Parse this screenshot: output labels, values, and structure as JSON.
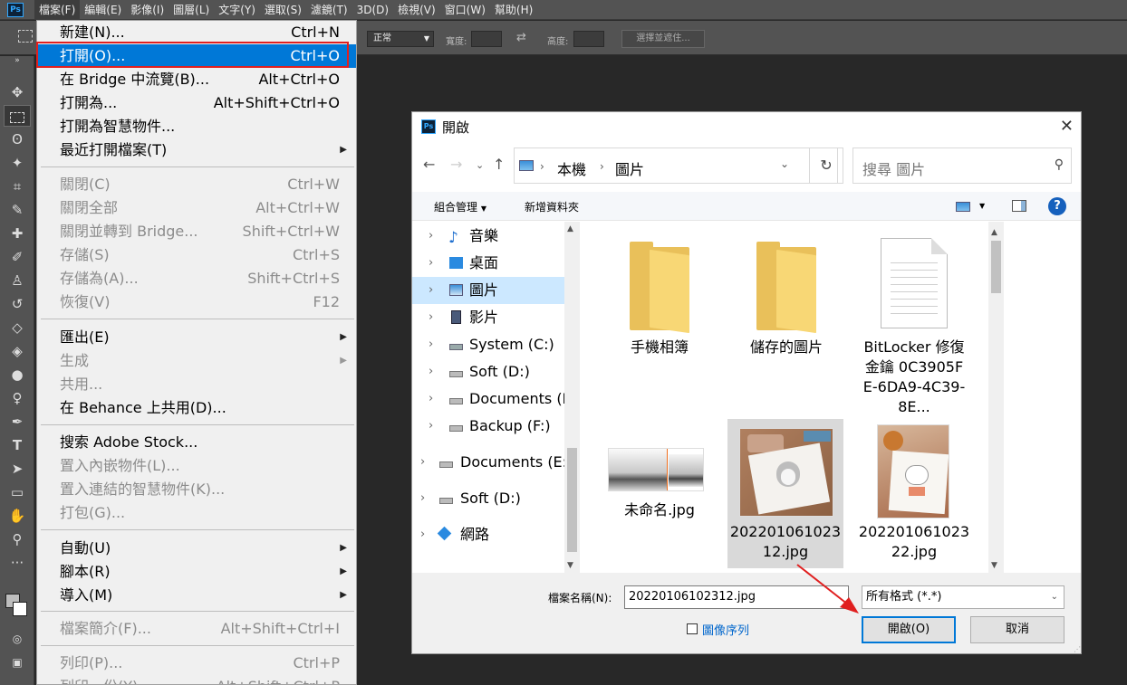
{
  "menubar": {
    "logo": "Ps",
    "items": [
      "檔案(F)",
      "編輯(E)",
      "影像(I)",
      "圖層(L)",
      "文字(Y)",
      "選取(S)",
      "濾鏡(T)",
      "3D(D)",
      "檢視(V)",
      "窗口(W)",
      "幫助(H)"
    ]
  },
  "options": {
    "style_value": "正常",
    "width_label": "寬度:",
    "height_label": "高度:",
    "select_mask": "選擇並遮住..."
  },
  "file_menu": {
    "items": [
      {
        "label": "新建(N)...",
        "shortcut": "Ctrl+N"
      },
      {
        "label": "打開(O)...",
        "shortcut": "Ctrl+O"
      },
      {
        "label": "在 Bridge 中流覽(B)...",
        "shortcut": "Alt+Ctrl+O"
      },
      {
        "label": "打開為...",
        "shortcut": "Alt+Shift+Ctrl+O"
      },
      {
        "label": "打開為智慧物件...",
        "shortcut": ""
      },
      {
        "label": "最近打開檔案(T)",
        "shortcut": ""
      },
      {
        "label": "關閉(C)",
        "shortcut": "Ctrl+W"
      },
      {
        "label": "關閉全部",
        "shortcut": "Alt+Ctrl+W"
      },
      {
        "label": "關閉並轉到 Bridge...",
        "shortcut": "Shift+Ctrl+W"
      },
      {
        "label": "存儲(S)",
        "shortcut": "Ctrl+S"
      },
      {
        "label": "存儲為(A)...",
        "shortcut": "Shift+Ctrl+S"
      },
      {
        "label": "恢復(V)",
        "shortcut": "F12"
      },
      {
        "label": "匯出(E)",
        "shortcut": ""
      },
      {
        "label": "生成",
        "shortcut": ""
      },
      {
        "label": "共用...",
        "shortcut": ""
      },
      {
        "label": "在 Behance 上共用(D)...",
        "shortcut": ""
      },
      {
        "label": "搜索 Adobe Stock...",
        "shortcut": ""
      },
      {
        "label": "置入內嵌物件(L)...",
        "shortcut": ""
      },
      {
        "label": "置入連結的智慧物件(K)...",
        "shortcut": ""
      },
      {
        "label": "打包(G)...",
        "shortcut": ""
      },
      {
        "label": "自動(U)",
        "shortcut": ""
      },
      {
        "label": "腳本(R)",
        "shortcut": ""
      },
      {
        "label": "導入(M)",
        "shortcut": ""
      },
      {
        "label": "檔案簡介(F)...",
        "shortcut": "Alt+Shift+Ctrl+I"
      },
      {
        "label": "列印(P)...",
        "shortcut": "Ctrl+P"
      },
      {
        "label": "列印一份(Y)",
        "shortcut": "Alt+Shift+Ctrl+P"
      }
    ]
  },
  "dialog": {
    "title": "開啟",
    "address": {
      "root": "本機",
      "folder": "圖片"
    },
    "search_placeholder": "搜尋 圖片",
    "toolbar": {
      "organize": "組合管理",
      "new_folder": "新增資料夾",
      "help": "?"
    },
    "nav": [
      {
        "label": "音樂"
      },
      {
        "label": "桌面"
      },
      {
        "label": "圖片"
      },
      {
        "label": "影片"
      },
      {
        "label": "System (C:)"
      },
      {
        "label": "Soft (D:)"
      },
      {
        "label": "Documents (E:)"
      },
      {
        "label": "Backup (F:)"
      },
      {
        "label": "Documents (E:)"
      },
      {
        "label": "Soft (D:)"
      },
      {
        "label": "網路"
      }
    ],
    "files": [
      {
        "name": "手機相簿"
      },
      {
        "name": "儲存的圖片"
      },
      {
        "name": "BitLocker 修復金鑰 0C3905FE-6DA9-4C39-8E..."
      },
      {
        "name": "未命名.jpg"
      },
      {
        "name": "20220106102312.jpg"
      },
      {
        "name": "20220106102322.jpg"
      }
    ],
    "filename_label": "檔案名稱(N):",
    "filename_value": "20220106102312.jpg",
    "filter_value": "所有格式 (*.*)",
    "image_sequence": "圖像序列",
    "open_button": "開啟(O)",
    "cancel_button": "取消"
  }
}
